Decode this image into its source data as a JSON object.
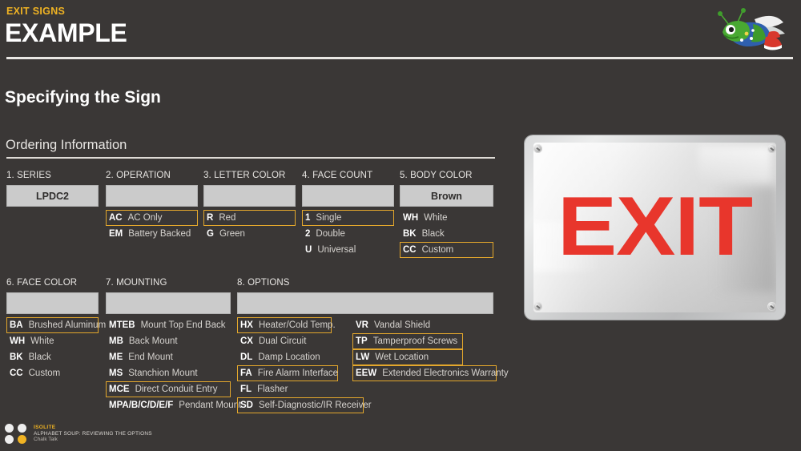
{
  "header": {
    "eyebrow": "EXIT SIGNS",
    "title": "EXAMPLE",
    "logo_name": "isolite-firefly-mascot-logo"
  },
  "section": {
    "title": "Specifying the Sign",
    "subtitle": "Ordering Information"
  },
  "accent_color": "#e3a72c",
  "background_color": "#3a3736",
  "columns": [
    {
      "id": "series",
      "heading": "1. SERIES",
      "value": "LPDC2",
      "options": []
    },
    {
      "id": "operation",
      "heading": "2. OPERATION",
      "value": "",
      "options": [
        {
          "code": "AC",
          "desc": "AC Only",
          "selected": true
        },
        {
          "code": "EM",
          "desc": "Battery Backed",
          "selected": false
        }
      ]
    },
    {
      "id": "letter-color",
      "heading": "3. LETTER COLOR",
      "value": "",
      "options": [
        {
          "code": "R",
          "desc": "Red",
          "selected": true
        },
        {
          "code": "G",
          "desc": "Green",
          "selected": false
        }
      ]
    },
    {
      "id": "face-count",
      "heading": "4. FACE COUNT",
      "value": "",
      "options": [
        {
          "code": "1",
          "desc": "Single",
          "selected": true
        },
        {
          "code": "2",
          "desc": "Double",
          "selected": false
        },
        {
          "code": "U",
          "desc": "Universal",
          "selected": false
        }
      ]
    },
    {
      "id": "body-color",
      "heading": "5. BODY COLOR",
      "value": "Brown",
      "options": [
        {
          "code": "WH",
          "desc": "White",
          "selected": false
        },
        {
          "code": "BK",
          "desc": "Black",
          "selected": false
        },
        {
          "code": "CC",
          "desc": "Custom",
          "selected": true
        }
      ]
    },
    {
      "id": "face-color",
      "heading": "6. FACE COLOR",
      "value": "",
      "options": [
        {
          "code": "BA",
          "desc": "Brushed Aluminum",
          "selected": true
        },
        {
          "code": "WH",
          "desc": "White",
          "selected": false
        },
        {
          "code": "BK",
          "desc": "Black",
          "selected": false
        },
        {
          "code": "CC",
          "desc": "Custom",
          "selected": false
        }
      ]
    },
    {
      "id": "mounting",
      "heading": "7. MOUNTING",
      "value": "",
      "options": [
        {
          "code": "MTEB",
          "desc": "Mount Top End Back",
          "selected": false
        },
        {
          "code": "MB",
          "desc": "Back Mount",
          "selected": false
        },
        {
          "code": "ME",
          "desc": "End Mount",
          "selected": false
        },
        {
          "code": "MS",
          "desc": "Stanchion Mount",
          "selected": false
        },
        {
          "code": "MCE",
          "desc": "Direct Conduit Entry",
          "selected": true
        },
        {
          "code": "MPA/B/C/D/E/F",
          "desc": "Pendant Mount",
          "selected": false
        }
      ]
    },
    {
      "id": "options",
      "heading": "8. OPTIONS",
      "value": "",
      "options": [
        {
          "code": "HX",
          "desc": "Heater/Cold Temp.",
          "selected": true
        },
        {
          "code": "CX",
          "desc": "Dual Circuit",
          "selected": false
        },
        {
          "code": "DL",
          "desc": "Damp Location",
          "selected": false
        },
        {
          "code": "FA",
          "desc": "Fire Alarm Interface",
          "selected": true
        },
        {
          "code": "FL",
          "desc": "Flasher",
          "selected": false
        },
        {
          "code": "SD",
          "desc": "Self-Diagnostic/IR Receiver",
          "selected": true
        }
      ],
      "options_b": [
        {
          "code": "VR",
          "desc": "Vandal Shield",
          "selected": false
        },
        {
          "code": "TP",
          "desc": "Tamperproof Screws",
          "selected": true
        },
        {
          "code": "LW",
          "desc": "Wet Location",
          "selected": true
        },
        {
          "code": "EEW",
          "desc": "Extended Electronics Warranty",
          "selected": true
        }
      ]
    }
  ],
  "sign": {
    "text": "EXIT",
    "letter_color": "#e8362c",
    "face_color": "#e6e6e6",
    "name": "exit-sign-photo"
  },
  "footer": {
    "brand": "ISOLITE",
    "line": "ALPHABET SOUP: REVIEWING THE OPTIONS",
    "sub": "Chalk Talk"
  }
}
